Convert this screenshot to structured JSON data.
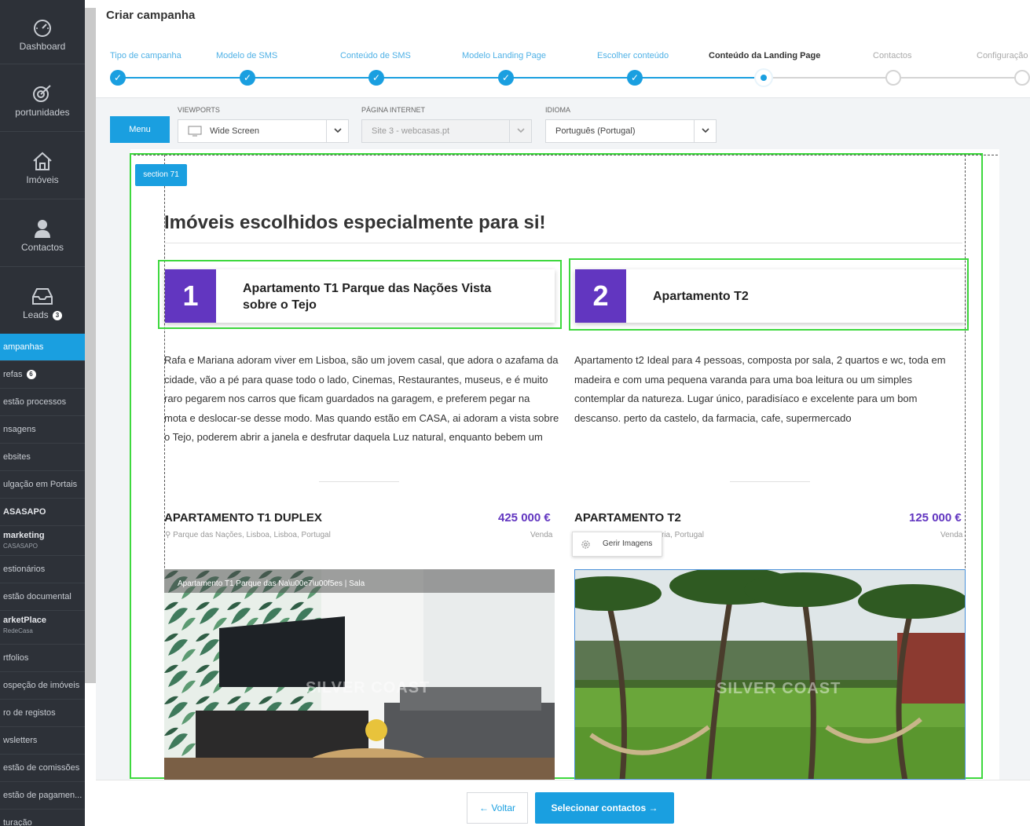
{
  "header": {
    "title": "Criar campanha"
  },
  "sidebar": {
    "big_items": [
      {
        "label": "Dashboard",
        "icon": "dashboard-icon"
      },
      {
        "label": "portunidades",
        "icon": "target-icon"
      },
      {
        "label": "Imóveis",
        "icon": "house-icon"
      },
      {
        "label": "Contactos",
        "icon": "person-icon"
      },
      {
        "label": "Leads",
        "icon": "inbox-icon",
        "badge": "3"
      }
    ],
    "small_items": [
      {
        "label": "ampanhas",
        "active": true
      },
      {
        "label": "refas",
        "badge": "6"
      },
      {
        "label": "estão processos"
      },
      {
        "label": "nsagens"
      },
      {
        "label": "ebsites"
      },
      {
        "label": "ulgação em Portais"
      },
      {
        "label": "ASASAPO",
        "bold": true
      },
      {
        "label": "marketing",
        "sub": "CASASAPO"
      },
      {
        "label": "estionários"
      },
      {
        "label": "estão documental"
      },
      {
        "label": "arketPlace",
        "sub": "RedeCasa"
      },
      {
        "label": "rtfolios"
      },
      {
        "label": "ospeção de imóveis"
      },
      {
        "label": "ro de registos"
      },
      {
        "label": "wsletters"
      },
      {
        "label": "estão de comissões"
      },
      {
        "label": "estão de pagamen..."
      },
      {
        "label": "turação"
      }
    ]
  },
  "stepper": {
    "steps": [
      {
        "label": "Tipo de campanha",
        "state": "done"
      },
      {
        "label": "Modelo de SMS",
        "state": "done"
      },
      {
        "label": "Conteúdo de SMS",
        "state": "done"
      },
      {
        "label": "Modelo Landing Page",
        "state": "done"
      },
      {
        "label": "Escolher conteúdo",
        "state": "done"
      },
      {
        "label": "Conteúdo da Landing Page",
        "state": "current"
      },
      {
        "label": "Contactos",
        "state": "pending"
      },
      {
        "label": "Configuração",
        "state": "pending"
      }
    ]
  },
  "toolbar": {
    "menu_label": "Menu",
    "viewports_label": "VIEWPORTS",
    "viewport_value": "Wide Screen",
    "page_label": "PÁGINA INTERNET",
    "page_value": "Site 3 - webcasas.pt",
    "language_label": "IDIOMA",
    "language_value": "Português (Portugal)"
  },
  "editor": {
    "section_tag": "section 71",
    "headline": "Imóveis escolhidos especialmente para si!",
    "gerir_label": "Gerir Imagens",
    "properties": [
      {
        "number": "1",
        "card_title_line1": "Apartamento T1 Parque das Nações Vista",
        "card_title_line2": "sobre o Tejo",
        "description_lines": [
          "Rafa e Mariana adoram viver em Lisboa, são um jovem casal, que adora o azafama da",
          "cidade, vão a pé para quase todo o lado, Cinemas, Restaurantes, museus, e é muito",
          "raro pegarem nos carros que ficam guardados na garagem, e preferem pegar na",
          "mota e deslocar-se desse modo. Mas quando estão em CASA, ai adoram a vista sobre",
          "o Tejo, poderem abrir a janela e desfrutar daquela Luz natural, enquanto bebem um"
        ],
        "title": "APARTAMENTO T1 DUPLEX",
        "price": "425 000 €",
        "location": "Parque das Nações, Lisboa, Lisboa, Portugal",
        "deal": "Venda",
        "photo_caption": "Apartamento T1 Parque das Na\\u00e7\\u00f5es | Sala",
        "watermark": "SILVER COAST"
      },
      {
        "number": "2",
        "card_title_line1": "Apartamento T2",
        "card_title_line2": "",
        "description_lines": [
          "Apartamento t2 Ideal para 4 pessoas, composta por sala, 2 quartos e wc, toda em",
          "madeira e com uma pequena varanda para uma boa leitura ou um simples",
          "contemplar da natureza. Lugar único, paradisíaco e excelente para um bom",
          "descanso. perto da castelo, da farmacia, cafe, supermercado"
        ],
        "title": "APARTAMENTO T2",
        "price": "125 000 €",
        "location": "ria, Portugal",
        "deal": "Venda",
        "watermark": "SILVER COAST"
      }
    ]
  },
  "footer": {
    "back_label": "Voltar",
    "next_label": "Selecionar contactos"
  },
  "colors": {
    "accent": "#1a9fe0",
    "purple": "#6236c0",
    "selection": "#3ed83e",
    "sidebar": "#2d3138"
  }
}
